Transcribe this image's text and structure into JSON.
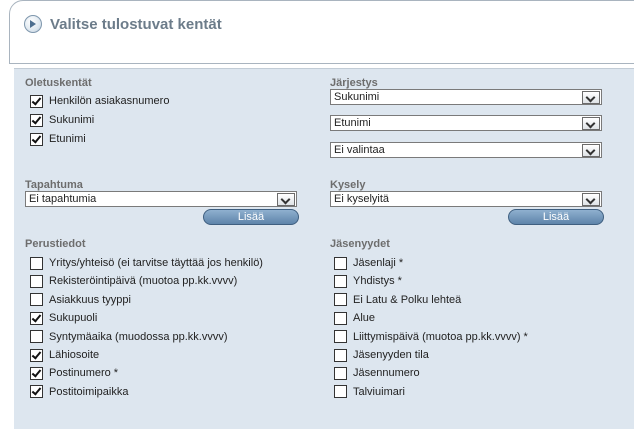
{
  "header": {
    "title": "Valitse tulostuvat kentät",
    "icon": "arrow-circle-right-icon"
  },
  "defaults": {
    "label": "Oletuskentät",
    "items": [
      {
        "label": "Henkilön asiakasnumero",
        "checked": true
      },
      {
        "label": "Sukunimi",
        "checked": true
      },
      {
        "label": "Etunimi",
        "checked": true
      }
    ]
  },
  "ordering": {
    "label": "Järjestys",
    "selects": [
      {
        "value": "Sukunimi"
      },
      {
        "value": "Etunimi"
      },
      {
        "value": "Ei valintaa"
      }
    ]
  },
  "event": {
    "label": "Tapahtuma",
    "value": "Ei tapahtumia",
    "add_label": "Lisää"
  },
  "query": {
    "label": "Kysely",
    "value": "Ei kyselyitä",
    "add_label": "Lisää"
  },
  "basic": {
    "label": "Perustiedot",
    "items": [
      {
        "label": "Yritys/yhteisö (ei tarvitse täyttää jos henkilö)",
        "checked": false
      },
      {
        "label": "Rekisteröintipäivä (muotoa pp.kk.vvvv)",
        "checked": false
      },
      {
        "label": "Asiakkuus tyyppi",
        "checked": false
      },
      {
        "label": "Sukupuoli",
        "checked": true
      },
      {
        "label": "Syntymäaika (muodossa pp.kk.vvvv)",
        "checked": false
      },
      {
        "label": "Lähiosoite",
        "checked": true
      },
      {
        "label": "Postinumero *",
        "checked": true
      },
      {
        "label": "Postitoimipaikka",
        "checked": true
      }
    ]
  },
  "memberships": {
    "label": "Jäsenyydet",
    "items": [
      {
        "label": "Jäsenlaji *",
        "checked": false
      },
      {
        "label": "Yhdistys *",
        "checked": false
      },
      {
        "label": "Ei Latu & Polku lehteä",
        "checked": false
      },
      {
        "label": "Alue",
        "checked": false
      },
      {
        "label": "Liittymispäivä (muotoa pp.kk.vvvv) *",
        "checked": false
      },
      {
        "label": "Jäsenyyden tila",
        "checked": false
      },
      {
        "label": "Jäsennumero",
        "checked": false
      },
      {
        "label": "Talviuimari",
        "checked": false
      }
    ]
  },
  "colors": {
    "panel_bg": "#dde6ef",
    "button": "#6b8fb3",
    "header_text": "#6c7c8a"
  }
}
